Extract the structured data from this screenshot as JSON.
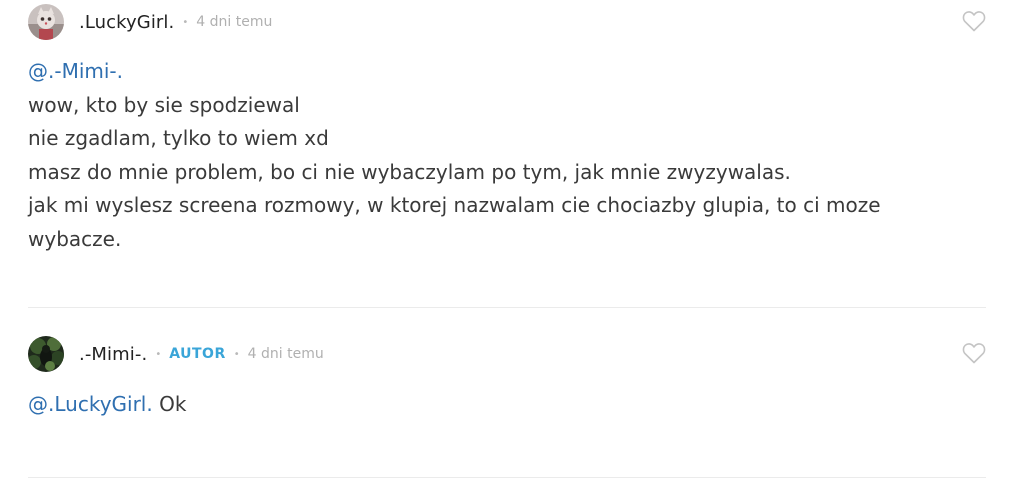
{
  "comments": [
    {
      "username": ".LuckyGirl.",
      "separator": "•",
      "time": "4 dni temu",
      "mention": "@.-Mimi-.",
      "lines": [
        "wow, kto by sie spodziewal",
        "nie zgadlam, tylko to wiem xd",
        "masz do mnie problem, bo ci nie wybaczylam po tym, jak mnie zwyzywalas.",
        "jak mi wyslesz screena rozmowy, w ktorej nazwalam cie chociazby glupia, to ci moze",
        "wybacze."
      ]
    },
    {
      "username": ".-Mimi-.",
      "separator": "•",
      "badge": "AUTOR",
      "separator2": "•",
      "time": "4 dni temu",
      "mention": "@.LuckyGirl.",
      "text": " Ok"
    }
  ],
  "icons": {
    "like": "heart-outline-icon"
  },
  "colors": {
    "mention": "#2f6fb0",
    "badge": "#3aa5d8",
    "meta": "#b0b0b0",
    "divider": "#ebebeb"
  }
}
